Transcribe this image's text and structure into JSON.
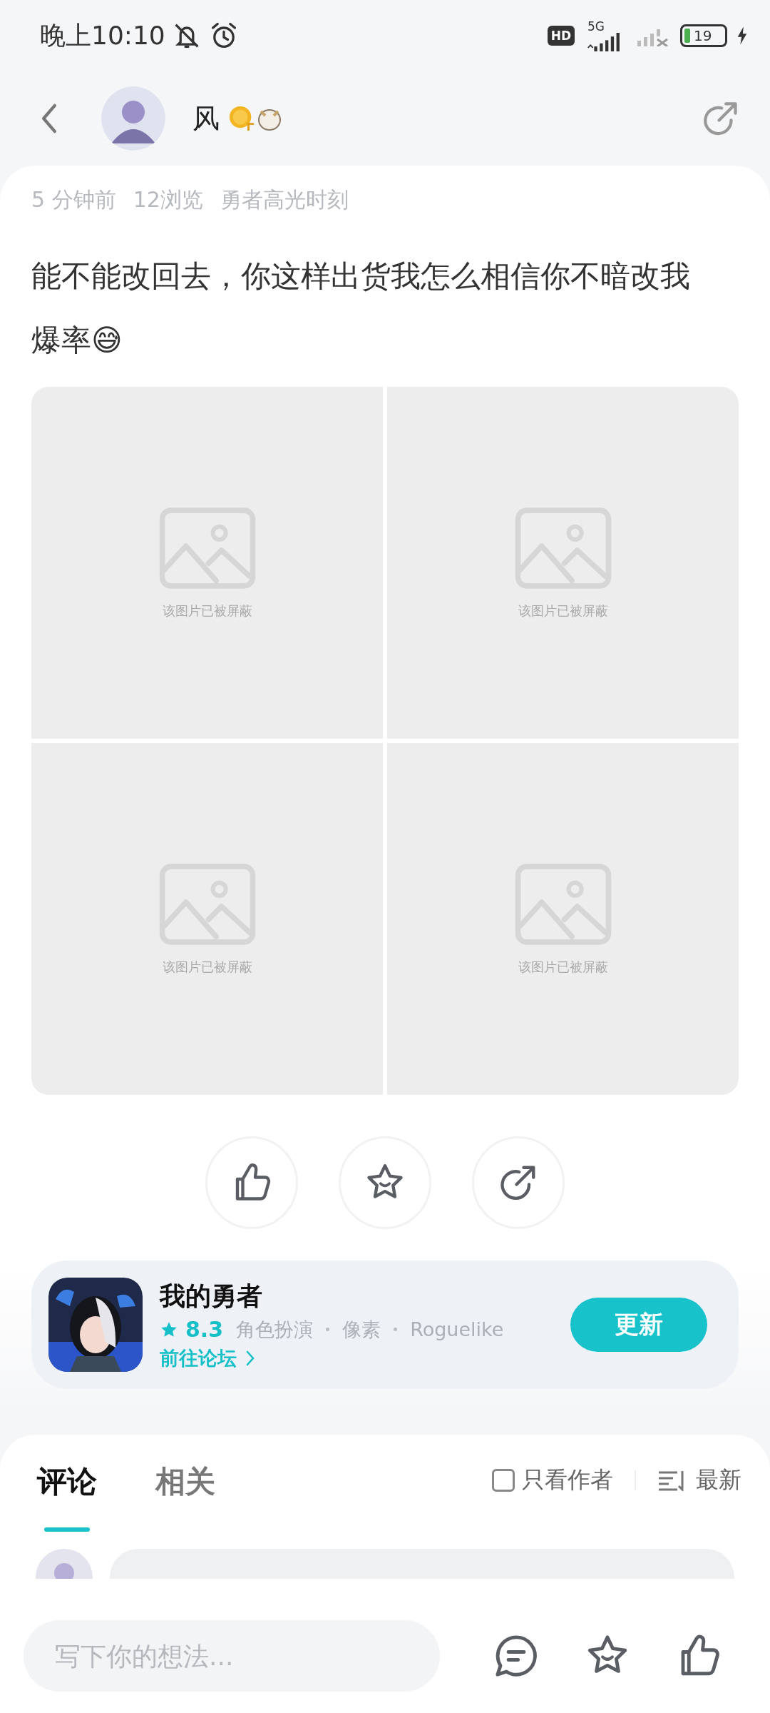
{
  "status_bar": {
    "time": "晚上10:10",
    "network_badge": "HD",
    "network_type": "5G",
    "battery": "19",
    "charging": true
  },
  "header": {
    "author": "风"
  },
  "post": {
    "meta": [
      "5 分钟前",
      "12浏览",
      "勇者高光时刻"
    ],
    "text": "能不能改回去，你这样出货我怎么相信你不暗改我爆率😅",
    "images": [
      {
        "notice": "该图片已被屏蔽"
      },
      {
        "notice": "该图片已被屏蔽"
      },
      {
        "notice": "该图片已被屏蔽"
      },
      {
        "notice": "该图片已被屏蔽"
      }
    ]
  },
  "game": {
    "name": "我的勇者",
    "rating": "8.3",
    "tags": [
      "角色扮演",
      "像素",
      "Roguelike"
    ],
    "link": "前往论坛",
    "button": "更新"
  },
  "comments": {
    "tabs": [
      {
        "label": "评论",
        "selected": true
      },
      {
        "label": "相关",
        "selected": false
      }
    ],
    "filter": {
      "label": "只看作者",
      "checked": false
    },
    "sort": {
      "label": "最新"
    }
  },
  "bottom_bar": {
    "placeholder": "写下你的想法..."
  }
}
